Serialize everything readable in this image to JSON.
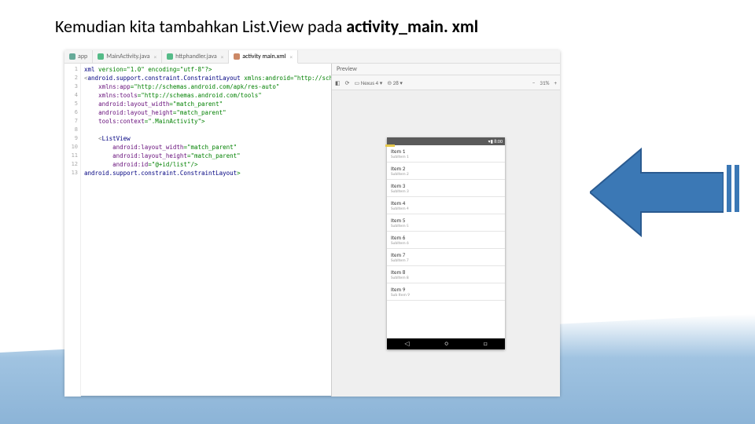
{
  "title_plain": "Kemudian kita tambahkan List.View pada ",
  "title_bold": "activity_main. xml",
  "tabs": [
    {
      "label": "app",
      "active": false
    },
    {
      "label": "MainActivity.java",
      "active": false
    },
    {
      "label": "httphandler.java",
      "active": false
    },
    {
      "label": "activity main.xml",
      "active": true
    }
  ],
  "gutter": [
    "1",
    "2",
    "3",
    "4",
    "5",
    "6",
    "7",
    "8",
    "9",
    "10",
    "11",
    "12",
    "13"
  ],
  "code_lines": [
    {
      "prefix": "<?",
      "tag": "xml",
      "rest": " version=\"1.0\" encoding=\"utf-8\"?>"
    },
    {
      "prefix": "<",
      "tag": "android.support.constraint.ConstraintLayout",
      "rest": " xmlns:android=\"http://sche"
    },
    {
      "prefix": "    ",
      "attr": "xmlns:app",
      "rest": "=\"http://schemas.android.com/apk/res-auto\""
    },
    {
      "prefix": "    ",
      "attr": "xmlns:tools",
      "rest": "=\"http://schemas.android.com/tools\""
    },
    {
      "prefix": "    ",
      "attr": "android:layout_width",
      "rest": "=\"match_parent\""
    },
    {
      "prefix": "    ",
      "attr": "android:layout_height",
      "rest": "=\"match_parent\""
    },
    {
      "prefix": "    ",
      "attr": "tools:context",
      "rest": "=\".MainActivity\">"
    },
    {
      "prefix": "",
      "rest": ""
    },
    {
      "prefix": "    <",
      "tag": "ListView",
      "rest": ""
    },
    {
      "prefix": "        ",
      "attr": "android:layout_width",
      "rest": "=\"match_parent\""
    },
    {
      "prefix": "        ",
      "attr": "android:layout_height",
      "rest": "=\"match_parent\""
    },
    {
      "prefix": "        ",
      "attr": "android:id",
      "rest": "=\"@+id/list\"/>"
    },
    {
      "prefix": "</",
      "tag": "android.support.constraint.ConstraintLayout",
      "rest": ">"
    }
  ],
  "preview": {
    "header": "Preview",
    "toolbar": {
      "device": "Nexus 4",
      "api": "28",
      "zoom_out": "−",
      "zoom_pct": "31%",
      "zoom_in": "+"
    },
    "status": "▾▮ 8:00",
    "items": [
      {
        "t": "Item 1",
        "s": "SubItem 1"
      },
      {
        "t": "Item 2",
        "s": "SubItem 2"
      },
      {
        "t": "Item 3",
        "s": "SubItem 3"
      },
      {
        "t": "Item 4",
        "s": "SubItem 4"
      },
      {
        "t": "Item 5",
        "s": "SubItem 5"
      },
      {
        "t": "Item 6",
        "s": "SubItem 6"
      },
      {
        "t": "Item 7",
        "s": "SubItem 7"
      },
      {
        "t": "Item 8",
        "s": "SubItem 8"
      },
      {
        "t": "Item 9",
        "s": "Sub Item 9"
      }
    ],
    "nav": {
      "back": "◁",
      "home": "○",
      "recent": "□"
    }
  }
}
